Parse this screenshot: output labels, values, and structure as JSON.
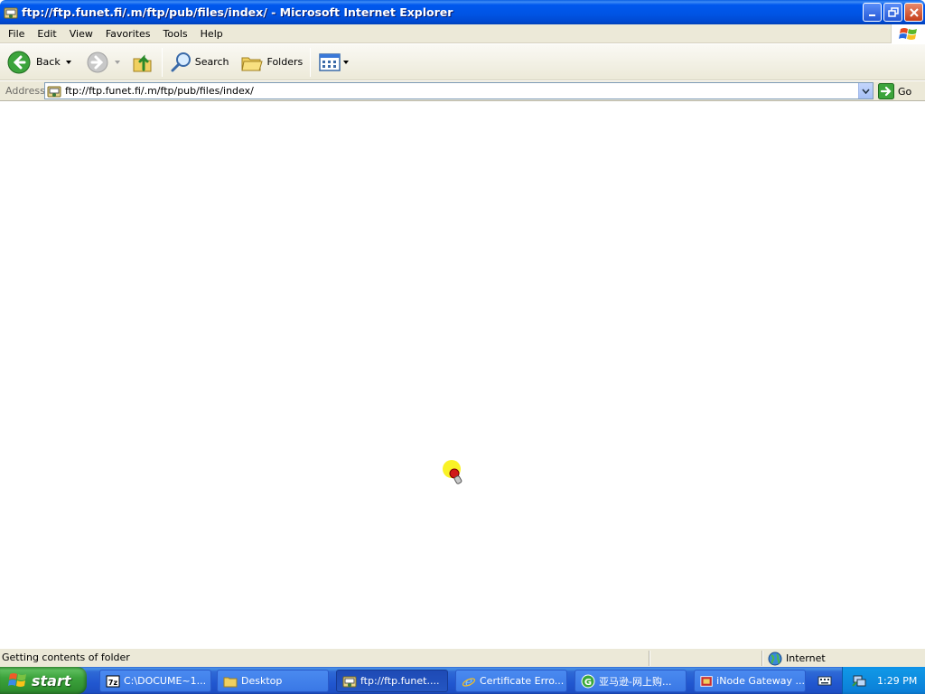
{
  "window": {
    "title": "ftp://ftp.funet.fi/.m/ftp/pub/files/index/ - Microsoft Internet Explorer"
  },
  "menu": {
    "items": [
      "File",
      "Edit",
      "View",
      "Favorites",
      "Tools",
      "Help"
    ]
  },
  "toolbar": {
    "back_label": "Back",
    "search_label": "Search",
    "folders_label": "Folders"
  },
  "address": {
    "label": "Address",
    "value": "ftp://ftp.funet.fi/.m/ftp/pub/files/index/",
    "go_label": "Go"
  },
  "status": {
    "text": "Getting contents of folder",
    "zone": "Internet"
  },
  "taskbar": {
    "start_label": "start",
    "tasks": [
      {
        "label": "C:\\DOCUME~1...",
        "icon": "7zip-icon"
      },
      {
        "label": "Desktop",
        "icon": "folder-icon"
      },
      {
        "label": "ftp://ftp.funet....",
        "icon": "ftp-icon",
        "active": true
      },
      {
        "label": "Certificate Erro...",
        "icon": "ie-icon"
      },
      {
        "label": "亚马逊-网上购...",
        "icon": "browser-icon"
      },
      {
        "label": "iNode Gateway ...",
        "icon": "inode-icon"
      }
    ],
    "clock": "1:29 PM"
  },
  "colors": {
    "title_blue": "#0054e3",
    "chrome": "#ece9d8",
    "start_green": "#3da33d",
    "close_red": "#c53e1a"
  }
}
